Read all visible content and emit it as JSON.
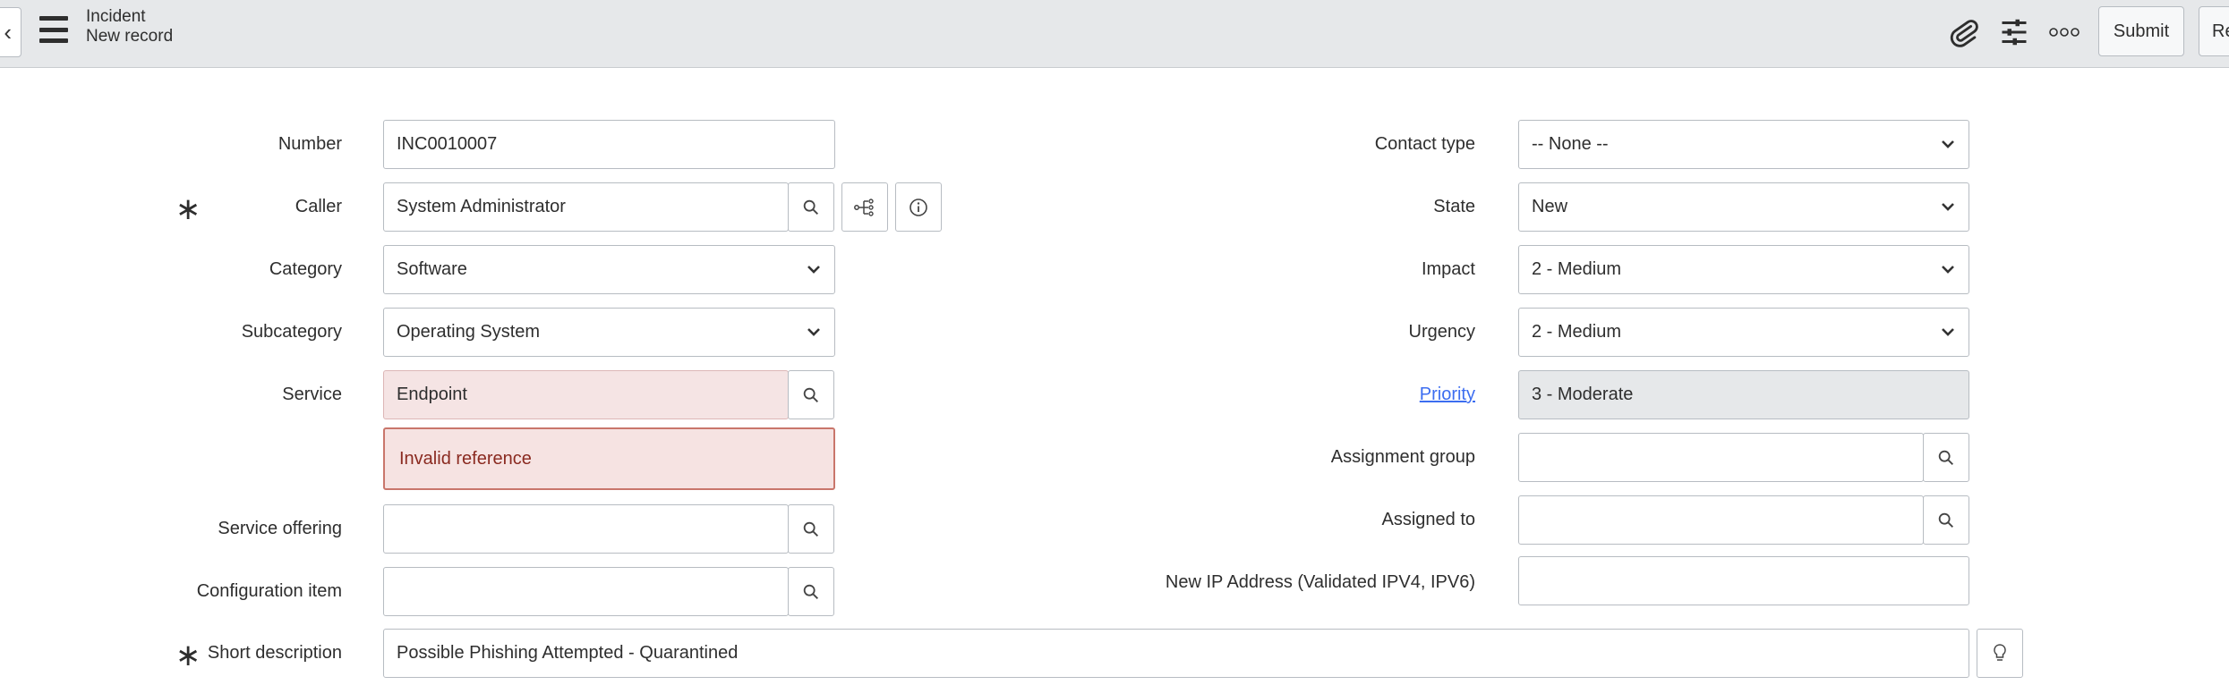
{
  "header": {
    "back_icon": "chevron-left-icon",
    "menu_icon": "hamburger-icon",
    "title": "Incident",
    "subtitle": "New record",
    "attachment_icon": "paperclip-icon",
    "settings_icon": "sliders-icon",
    "more_icon": "ellipsis-icon",
    "submit_label": "Submit",
    "resolve_label": "Re"
  },
  "form": {
    "number": {
      "label": "Number",
      "value": "INC0010007"
    },
    "caller": {
      "label": "Caller",
      "value": "System Administrator",
      "required": true
    },
    "category": {
      "label": "Category",
      "value": "Software"
    },
    "subcategory": {
      "label": "Subcategory",
      "value": "Operating System"
    },
    "service": {
      "label": "Service",
      "value": "Endpoint",
      "error": "Invalid reference"
    },
    "service_offering": {
      "label": "Service offering",
      "value": ""
    },
    "configuration_item": {
      "label": "Configuration item",
      "value": ""
    },
    "short_description": {
      "label": "Short description",
      "value": "Possible Phishing Attempted - Quarantined",
      "required": true
    },
    "contact_type": {
      "label": "Contact type",
      "value": "-- None --"
    },
    "state": {
      "label": "State",
      "value": "New"
    },
    "impact": {
      "label": "Impact",
      "value": "2 - Medium"
    },
    "urgency": {
      "label": "Urgency",
      "value": "2 - Medium"
    },
    "priority": {
      "label": "Priority",
      "value": "3 - Moderate"
    },
    "assignment_group": {
      "label": "Assignment group",
      "value": ""
    },
    "assigned_to": {
      "label": "Assigned to",
      "value": ""
    },
    "new_ip": {
      "label": "New IP Address (Validated IPV4, IPV6)",
      "value": ""
    }
  },
  "colors": {
    "header_bg": "#e6e8ea",
    "error_bg": "#f6e3e2",
    "error_border": "#c9766b",
    "link": "#3c6df0"
  }
}
